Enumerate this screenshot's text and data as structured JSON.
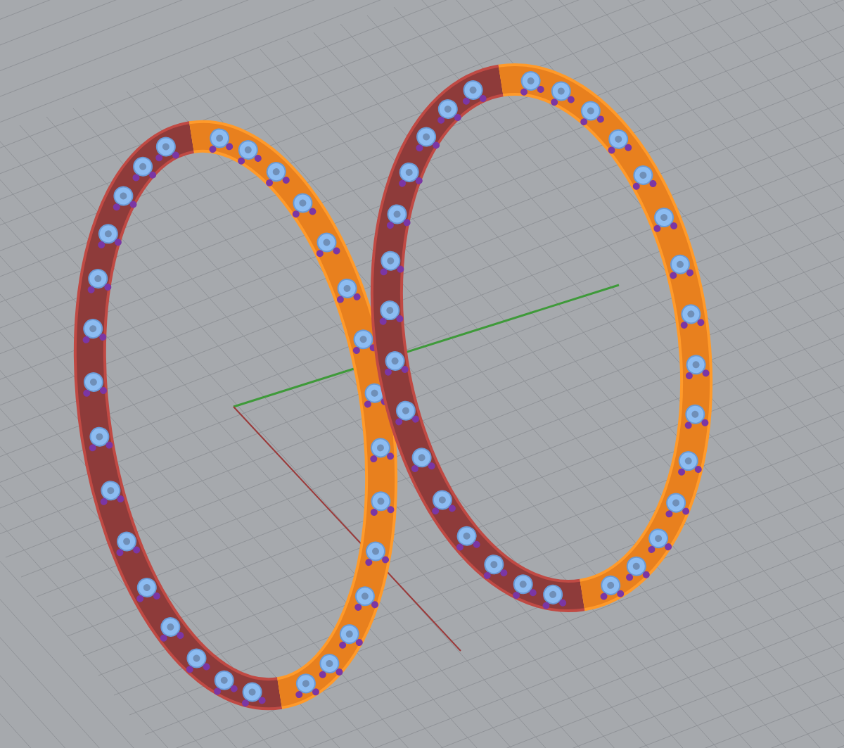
{
  "earrings": [
    {
      "halves": [
        {
          "selected": false
        },
        {
          "selected": true
        }
      ]
    },
    {
      "halves": [
        {
          "selected": false
        },
        {
          "selected": true
        }
      ]
    }
  ]
}
